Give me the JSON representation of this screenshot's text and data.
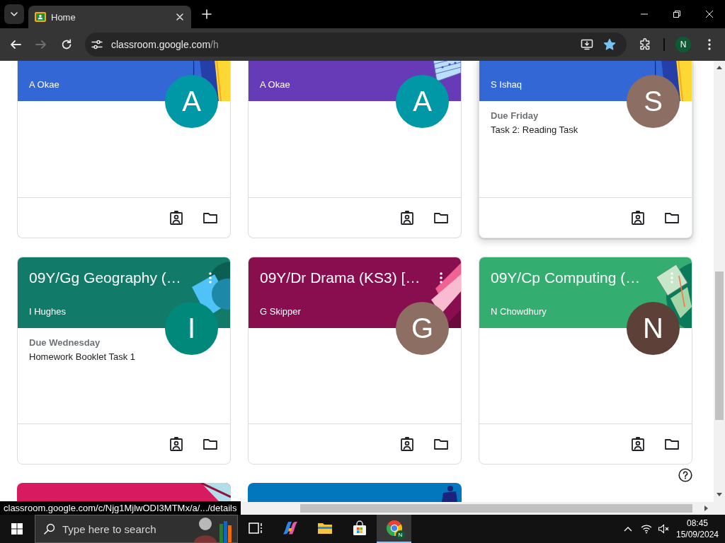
{
  "browser": {
    "tabs": [
      {
        "title": "Home",
        "selected": true
      }
    ],
    "nav": [
      {
        "kind": "back",
        "disabled": false
      },
      {
        "kind": "forward",
        "disabled": true
      },
      {
        "kind": "reload",
        "disabled": false
      }
    ],
    "address": {
      "host": "classroom.google.com",
      "path": "/h"
    },
    "bookmarked": true,
    "profile": "N"
  },
  "cards": [
    {
      "kind": "notebook",
      "teacher": "A Okae",
      "color": "#3367d6",
      "avatar": {
        "letter": "A",
        "color": "#0097a7"
      },
      "hovered": false
    },
    {
      "kind": "music",
      "teacher": "A Okae",
      "color": "#673ab7",
      "avatar": {
        "letter": "A",
        "color": "#0097a7"
      },
      "hovered": false
    },
    {
      "kind": "notebook",
      "teacher": "S Ishaq",
      "color": "#3367d6",
      "avatar": {
        "letter": "S",
        "color": "#8d6e63"
      },
      "due": "Due Friday",
      "task": "Task 2: Reading Task",
      "hovered": true
    },
    {
      "kind": "globe",
      "title": "09Y/Gg Geography (…",
      "teacher": "I Hughes",
      "color": "#127a68",
      "avatar": {
        "letter": "I",
        "color": "#00897b"
      },
      "due": "Due Wednesday",
      "task": "Homework Booklet Task 1",
      "hovered": false
    },
    {
      "kind": "masks",
      "title": "09Y/Dr Drama (KS3) […",
      "teacher": "G Skipper",
      "color": "#880e4f",
      "avatar": {
        "letter": "G",
        "color": "#8d6e63"
      },
      "hovered": false
    },
    {
      "kind": "books",
      "title": "09Y/Cp Computing (…",
      "teacher": "N Chowdhury",
      "color": "#34ad71",
      "avatar": {
        "letter": "N",
        "color": "#5d4037"
      },
      "hovered": false
    },
    {
      "kind": "paper",
      "color": "#d81b60",
      "hovered": false
    },
    {
      "kind": "shapes",
      "color": "#0277bd",
      "hovered": false
    }
  ],
  "status_link": "classroom.google.com/c/Njg1MjlwODI3MTMx/a/.../details",
  "taskbar": {
    "search": {
      "placeholder": "Type here to search"
    },
    "apps": [
      {
        "kind": "task-view",
        "selected": false
      },
      {
        "kind": "copilot",
        "selected": false
      },
      {
        "kind": "file-explorer",
        "selected": false
      },
      {
        "kind": "store",
        "selected": false
      },
      {
        "kind": "chrome",
        "selected": true,
        "badge": "N"
      }
    ],
    "time": "08:45",
    "date": "15/09/2024"
  }
}
